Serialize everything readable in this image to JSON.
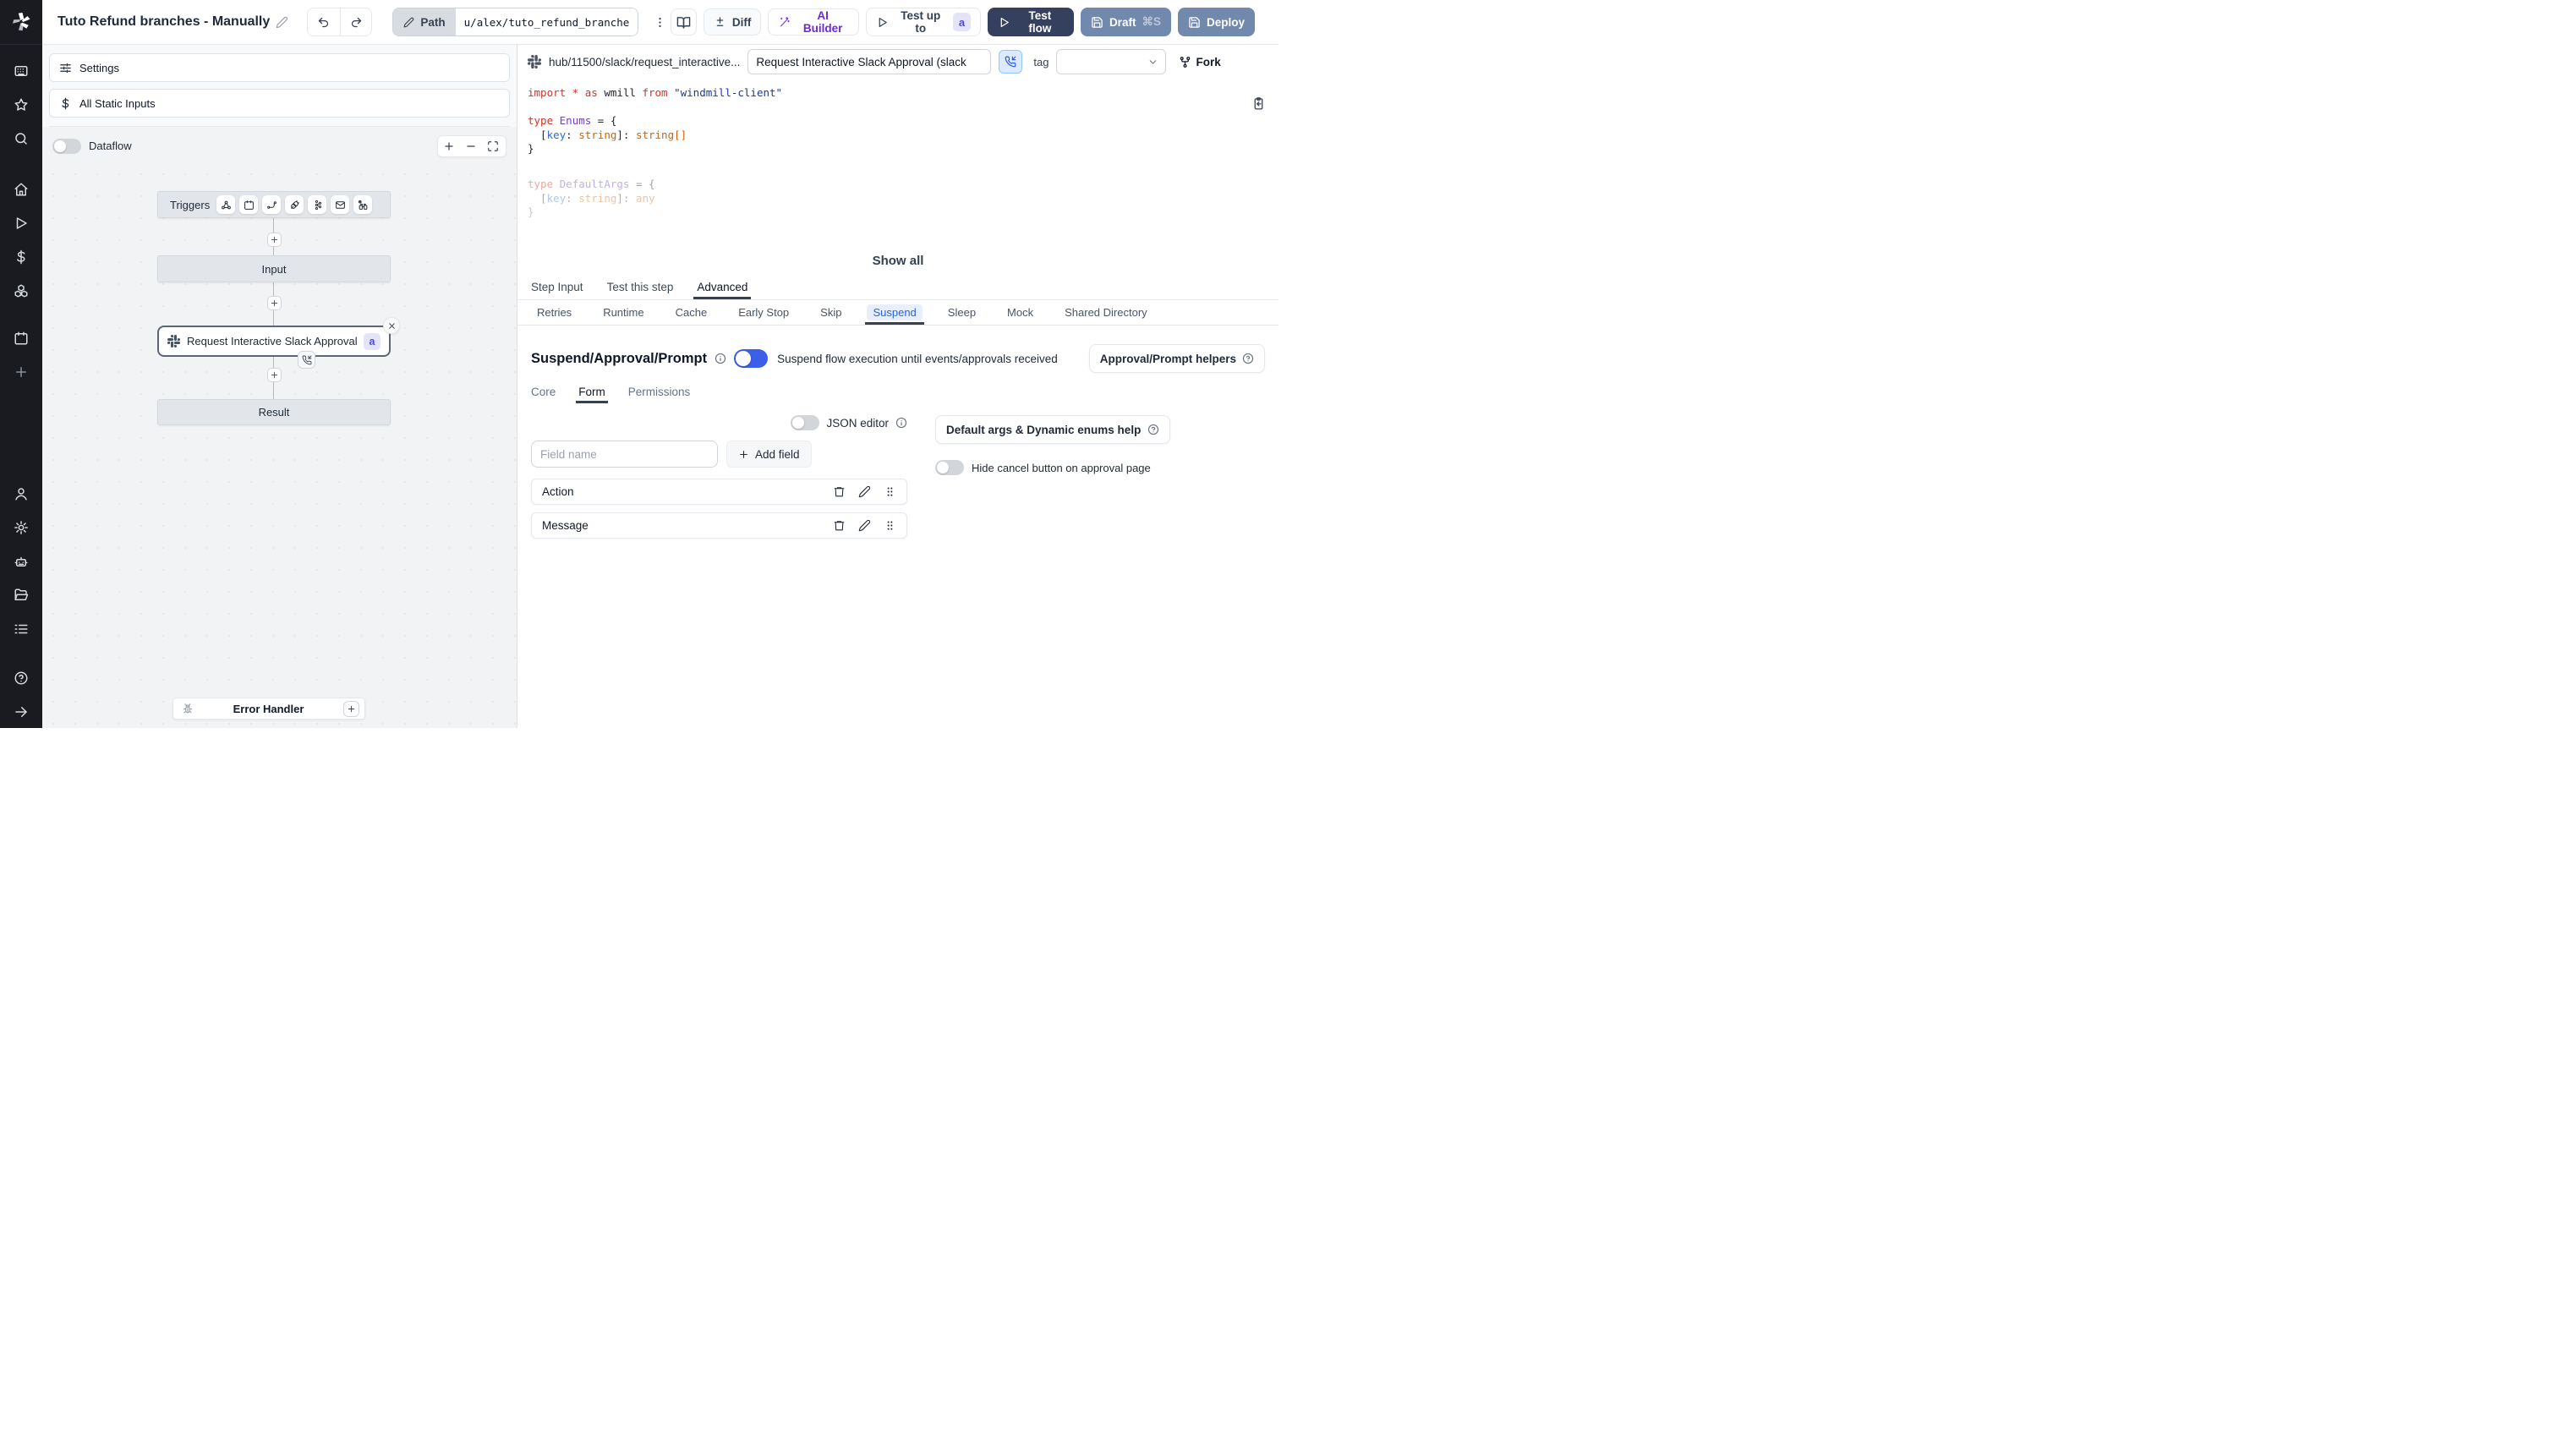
{
  "topbar": {
    "title": "Tuto Refund branches - Manually",
    "path_label": "Path",
    "path_value": "u/alex/tuto_refund_branches_",
    "diff_label": "Diff",
    "ai_builder_label": "AI Builder",
    "test_up_to_label": "Test up to",
    "test_up_to_badge": "a",
    "test_flow_label": "Test flow",
    "draft_label": "Draft",
    "draft_shortcut": "⌘S",
    "deploy_label": "Deploy"
  },
  "left_panel": {
    "settings_label": "Settings",
    "static_inputs_label": "All Static Inputs",
    "dataflow_label": "Dataflow",
    "flow": {
      "triggers_label": "Triggers",
      "trigger_icons": [
        "webhook",
        "schedule",
        "http-route",
        "websocket",
        "kafka",
        "email",
        "scheduled-poll"
      ],
      "input_label": "Input",
      "step_label": "Request Interactive Slack Approval (...",
      "step_badge": "a",
      "result_label": "Result",
      "error_handler_label": "Error Handler"
    }
  },
  "right_panel": {
    "header": {
      "hub_path": "hub/11500/slack/request_interactive...",
      "name_value": "Request Interactive Slack Approval (slack",
      "tag_label": "tag",
      "fork_label": "Fork"
    },
    "code": {
      "lines": [
        [
          [
            "k",
            "import * as "
          ],
          [
            "p",
            "wmill"
          ],
          [
            "k",
            " from "
          ],
          [
            "s",
            "\"windmill-client\""
          ]
        ],
        [],
        [
          [
            "k",
            "type "
          ],
          [
            "t",
            "Enums"
          ],
          [
            "p",
            " = {"
          ]
        ],
        [
          [
            "p",
            "  ["
          ],
          [
            "b",
            "key"
          ],
          [
            "p",
            ": "
          ],
          [
            "o",
            "string"
          ],
          [
            "p",
            "]: "
          ],
          [
            "o",
            "string[]"
          ]
        ],
        [
          [
            "p",
            "}"
          ]
        ],
        []
      ],
      "faded_lines": [
        [
          [
            "k",
            "type "
          ],
          [
            "t",
            "DefaultArgs"
          ],
          [
            "p",
            " = {"
          ]
        ],
        [
          [
            "p",
            "  ["
          ],
          [
            "b",
            "key"
          ],
          [
            "p",
            ": "
          ],
          [
            "o",
            "string"
          ],
          [
            "p",
            "]: "
          ],
          [
            "o",
            "any"
          ]
        ],
        [
          [
            "p",
            "}"
          ]
        ]
      ],
      "show_all_label": "Show all"
    },
    "tabs": [
      "Step Input",
      "Test this step",
      "Advanced"
    ],
    "active_tab": "Advanced",
    "subtabs": [
      "Retries",
      "Runtime",
      "Cache",
      "Early Stop",
      "Skip",
      "Suspend",
      "Sleep",
      "Mock",
      "Shared Directory"
    ],
    "active_subtab": "Suspend",
    "suspend": {
      "heading": "Suspend/Approval/Prompt",
      "toggle_text": "Suspend flow execution until events/approvals received",
      "helpers_label": "Approval/Prompt helpers",
      "inner_tabs": [
        "Core",
        "Form",
        "Permissions"
      ],
      "active_inner_tab": "Form",
      "json_editor_label": "JSON editor",
      "field_placeholder": "Field name",
      "add_field_label": "Add field",
      "fields": [
        "Action",
        "Message"
      ],
      "default_args_label": "Default args & Dynamic enums help",
      "hide_cancel_label": "Hide cancel button on approval page"
    }
  }
}
